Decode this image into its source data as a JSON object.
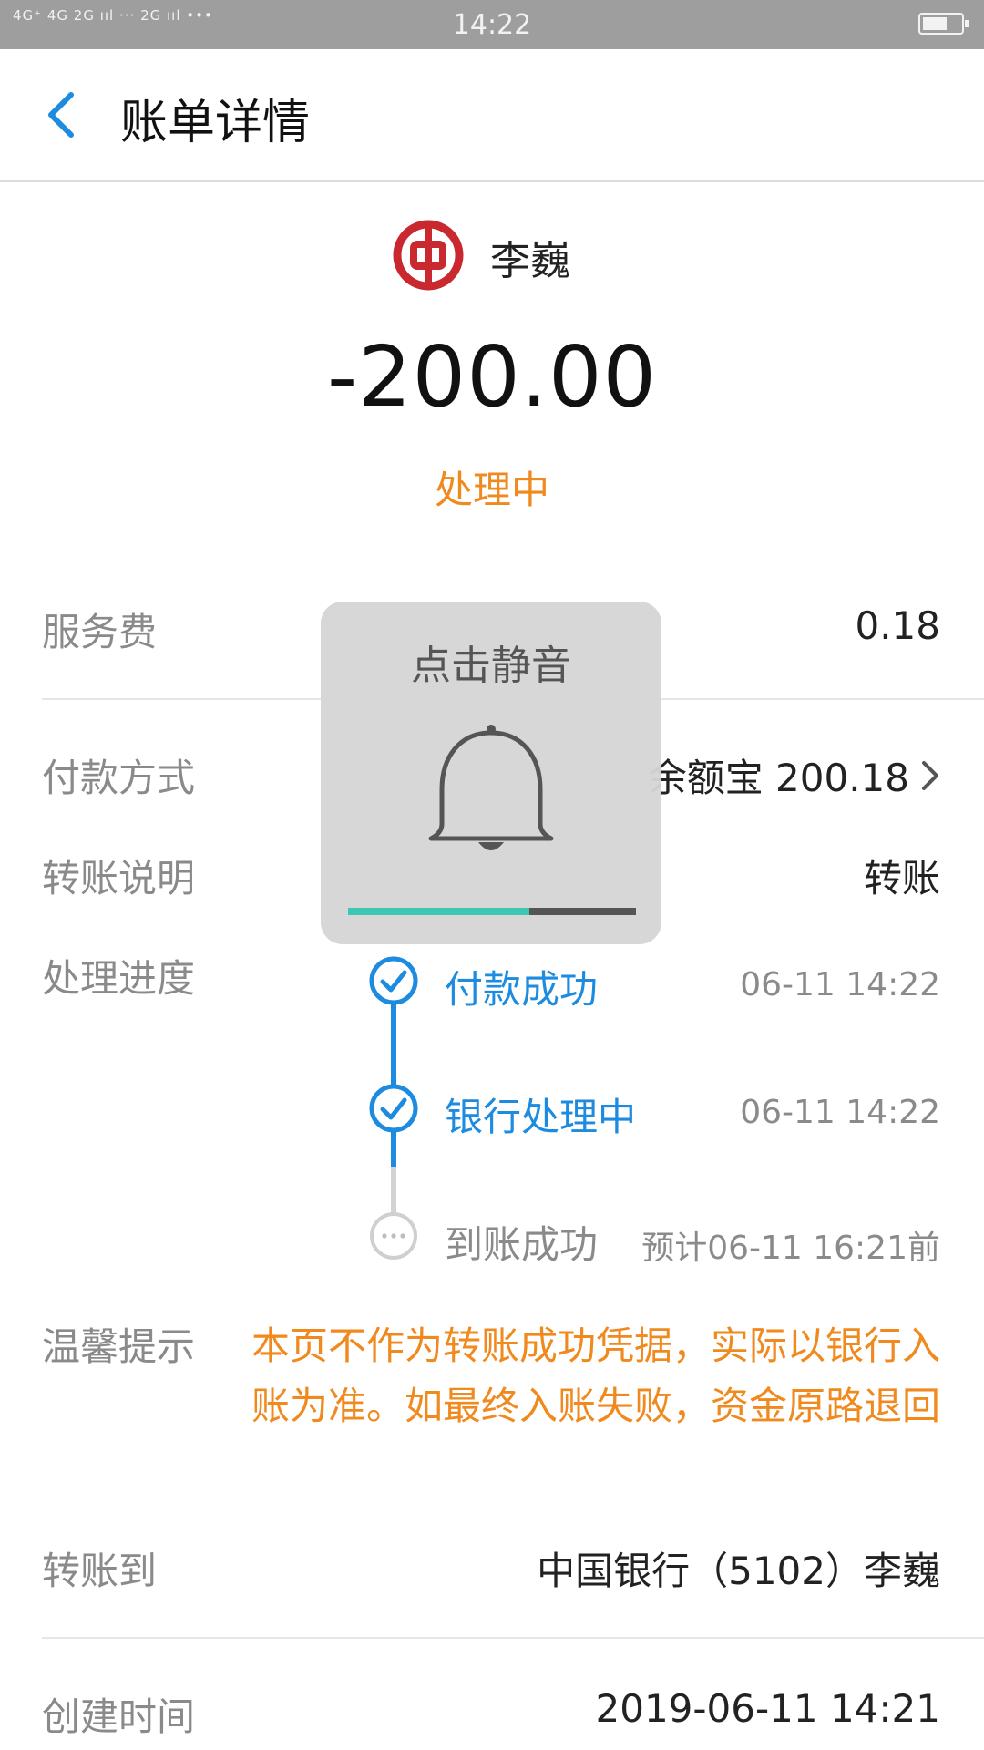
{
  "status_bar": {
    "signal_text": "4G⁺ 4G 2G ııl ··· 2G ııl  •••",
    "time": "14:22"
  },
  "header": {
    "title": "账单详情"
  },
  "payee": {
    "name": "李巍"
  },
  "amount": "-200.00",
  "status": "处理中",
  "rows": {
    "service_fee": {
      "label": "服务费",
      "value": "0.18"
    },
    "payment_method": {
      "label": "付款方式",
      "value": "余额宝 200.18"
    },
    "transfer_note": {
      "label": "转账说明",
      "value": "转账"
    },
    "progress_label": "处理进度"
  },
  "progress": [
    {
      "text": "付款成功",
      "time": "06-11 14:22",
      "state": "done"
    },
    {
      "text": "银行处理中",
      "time": "06-11 14:22",
      "state": "done"
    },
    {
      "text": "到账成功",
      "time": "预计06-11 16:21前",
      "state": "pending"
    }
  ],
  "tip": {
    "label": "温馨提示",
    "text": "本页不作为转账成功凭据，实际以银行入账为准。如最终入账失败，资金原路退回"
  },
  "transfer_to": {
    "label": "转账到",
    "value": "中国银行（5102）李巍"
  },
  "created_time": {
    "label": "创建时间",
    "value": "2019-06-11 14:21"
  },
  "toast": {
    "title": "点击静音",
    "volume_level": 0.63
  },
  "colors": {
    "accent_blue": "#1c8be0",
    "status_orange": "#f0891e",
    "bank_red": "#c8282e",
    "volume_teal": "#3cc7b5"
  },
  "icons": {
    "back": "chevron-left-icon",
    "bank": "bank-of-china-logo",
    "bell": "bell-icon",
    "check": "check-circle-icon",
    "pending": "ellipsis-circle-icon"
  }
}
